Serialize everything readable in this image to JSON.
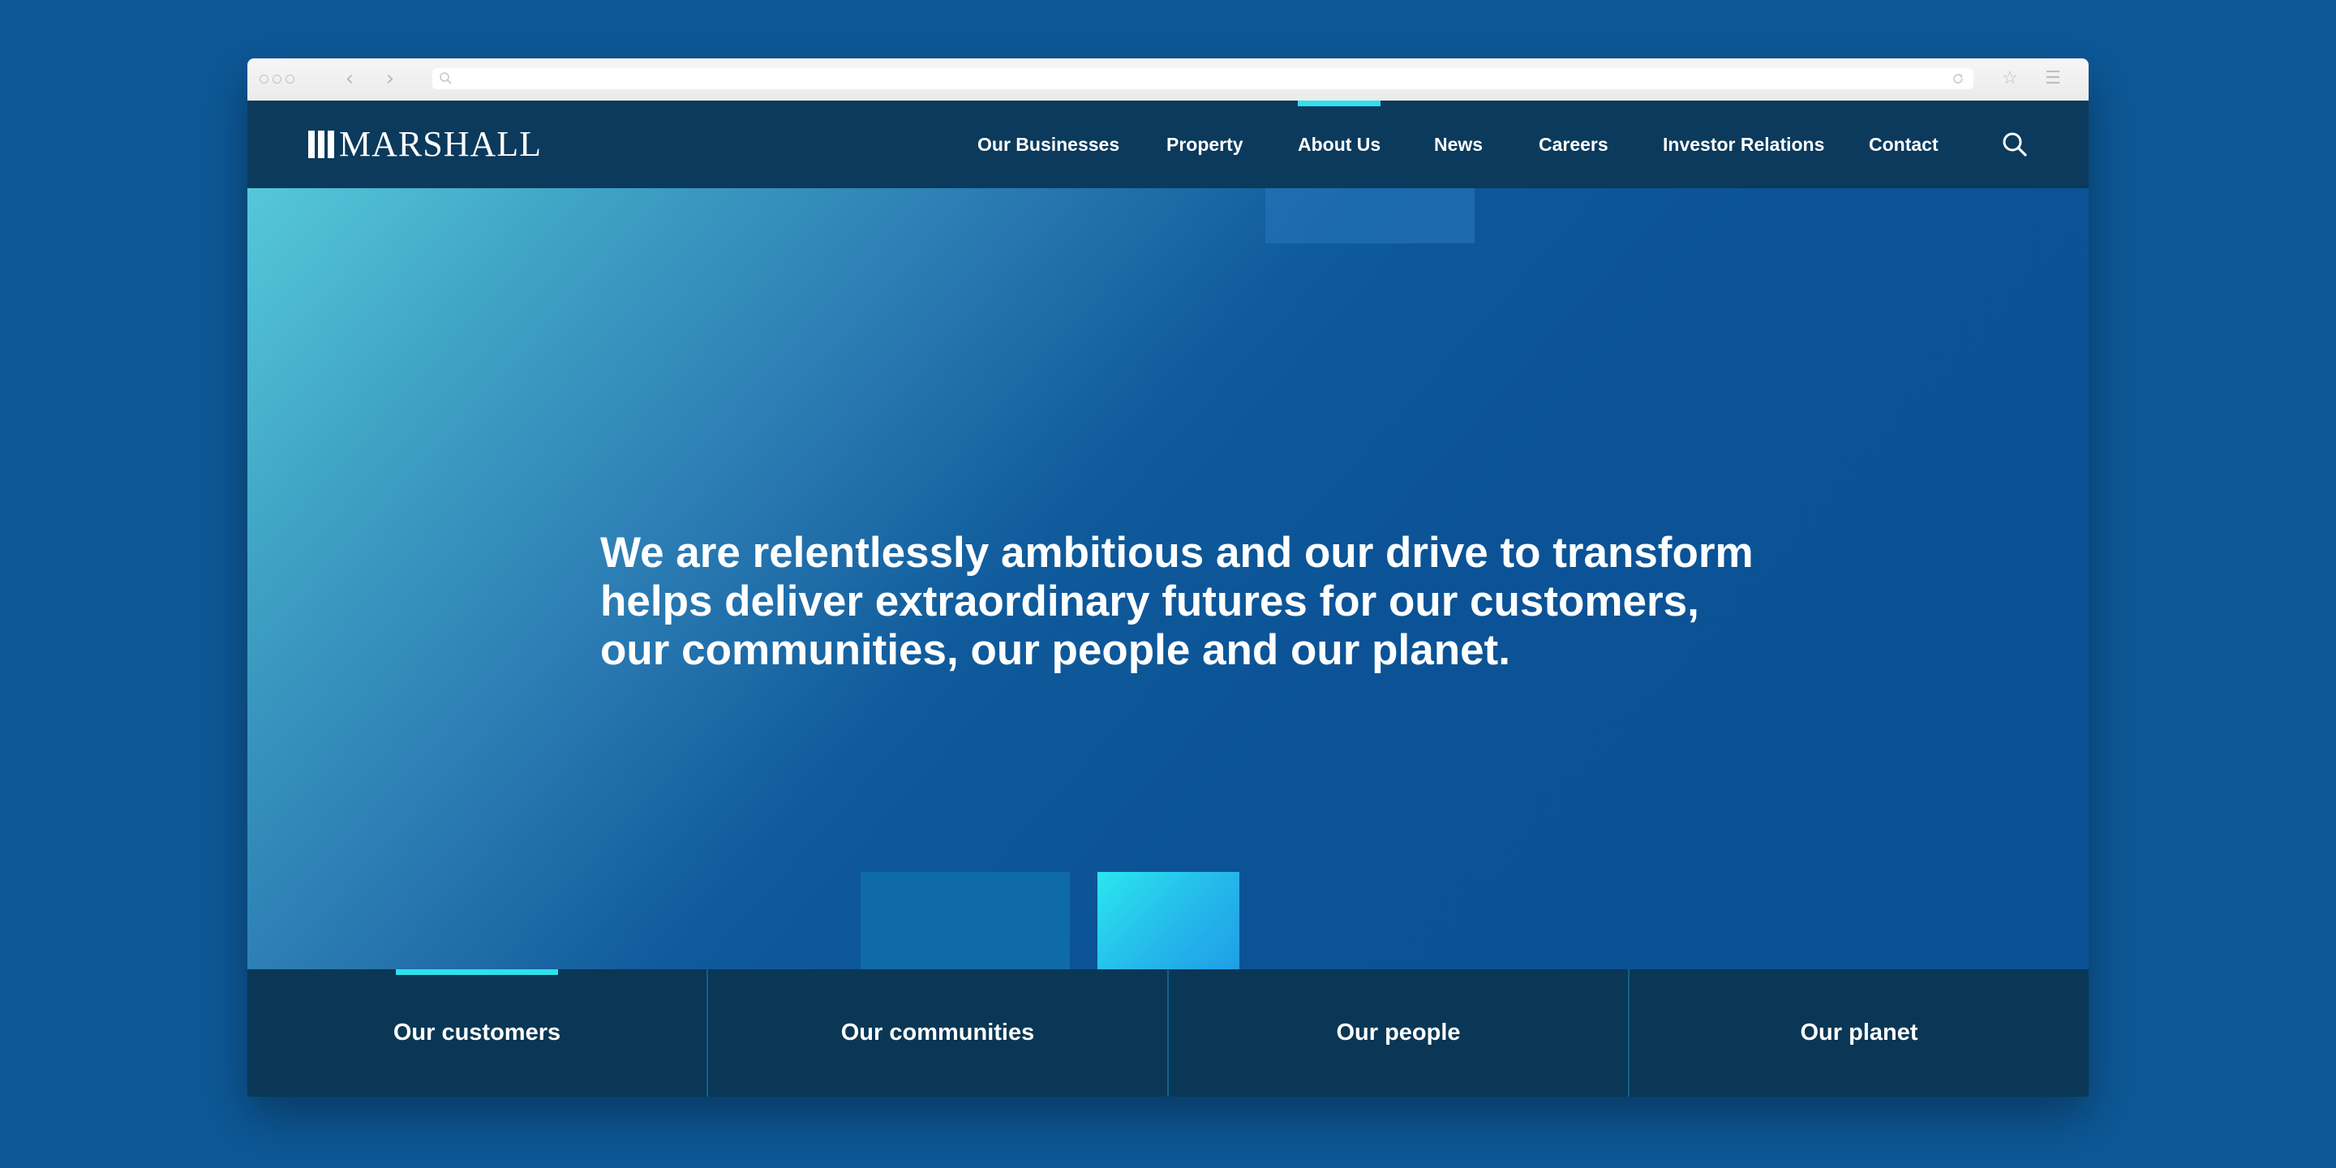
{
  "colors": {
    "page_background": "#0d5897",
    "header_background": "#0b3a5c",
    "accent": "#2ee0ec",
    "tabs_background": "#093755"
  },
  "browser": {
    "back_icon": "chevron-left-icon",
    "forward_icon": "chevron-right-icon",
    "url_search_icon": "search-icon",
    "reload_icon": "reload-icon",
    "bookmark_icon": "star-icon",
    "menu_icon": "menu-icon"
  },
  "header": {
    "logo_text": "MARSHALL",
    "nav": [
      {
        "label": "Our Businesses"
      },
      {
        "label": "Property"
      },
      {
        "label": "About Us",
        "active": true
      },
      {
        "label": "News"
      },
      {
        "label": "Careers"
      },
      {
        "label": "Investor Relations"
      },
      {
        "label": "Contact"
      }
    ],
    "search_icon": "search-icon"
  },
  "hero": {
    "lines": [
      "We are relentlessly ambitious and our drive to transform",
      "helps deliver extraordinary futures for our customers,",
      "our communities, our people and our planet."
    ]
  },
  "tabs": [
    {
      "label": "Our customers",
      "active": true
    },
    {
      "label": "Our communities"
    },
    {
      "label": "Our people"
    },
    {
      "label": "Our planet"
    }
  ]
}
